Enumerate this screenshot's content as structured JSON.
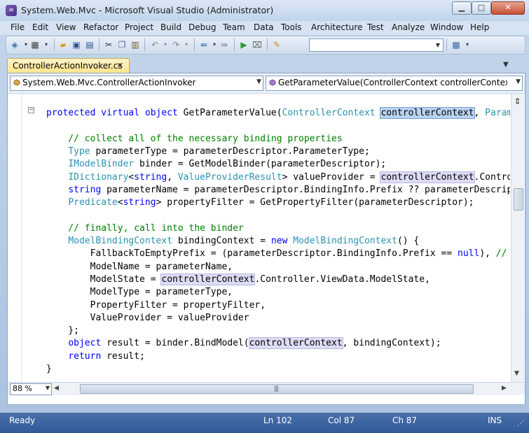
{
  "window": {
    "title": "System.Web.Mvc - Microsoft Visual Studio (Administrator)",
    "controls": {
      "minimize": "▁",
      "maximize": "□",
      "close": "✕"
    }
  },
  "menu": [
    "File",
    "Edit",
    "View",
    "Refactor",
    "Project",
    "Build",
    "Debug",
    "Team",
    "Data",
    "Tools",
    "Architecture",
    "Test",
    "Analyze",
    "Window",
    "Help"
  ],
  "toolbar": {
    "icons": [
      "project-icon",
      "add-item-icon",
      "open-icon",
      "save-icon",
      "save-all-icon",
      "cut-icon",
      "copy-icon",
      "paste-icon",
      "undo-icon",
      "redo-icon",
      "navigate-back-icon",
      "navigate-forward-icon",
      "start-debug-icon",
      "attach-icon",
      "find-in-files-icon",
      "solution-explorer-icon"
    ],
    "find_value": ""
  },
  "tab": {
    "label": "ControllerActionInvoker.cs",
    "close": "✕",
    "overflow": "▼"
  },
  "navigation": {
    "type_combo": "System.Web.Mvc.ControllerActionInvoker",
    "member_combo": "GetParameterValue(ControllerContext controllerContext, Para"
  },
  "code": {
    "collapse_glyph": "−",
    "lines": [
      [
        {
          "t": "protected virtual object ",
          "c": "kw"
        },
        {
          "t": "GetParameterValue(",
          "c": ""
        },
        {
          "t": "ControllerContext",
          "c": "ty"
        },
        {
          "t": " ",
          "c": ""
        },
        {
          "t": "controllerContext",
          "c": "hl-sel"
        },
        {
          "t": ", ",
          "c": ""
        },
        {
          "t": "Param",
          "c": "ty"
        }
      ],
      [],
      [
        {
          "t": "    // collect all of the necessary binding properties",
          "c": "cm"
        }
      ],
      [
        {
          "t": "    ",
          "c": ""
        },
        {
          "t": "Type",
          "c": "ty"
        },
        {
          "t": " parameterType = parameterDescriptor.ParameterType;",
          "c": ""
        }
      ],
      [
        {
          "t": "    ",
          "c": ""
        },
        {
          "t": "IModelBinder",
          "c": "ty"
        },
        {
          "t": " binder = GetModelBinder(parameterDescriptor);",
          "c": ""
        }
      ],
      [
        {
          "t": "    ",
          "c": ""
        },
        {
          "t": "IDictionary",
          "c": "ty"
        },
        {
          "t": "<",
          "c": ""
        },
        {
          "t": "string",
          "c": "kw"
        },
        {
          "t": ", ",
          "c": ""
        },
        {
          "t": "ValueProviderResult",
          "c": "ty"
        },
        {
          "t": "> valueProvider = ",
          "c": ""
        },
        {
          "t": "controllerContext",
          "c": "hl"
        },
        {
          "t": ".Contro",
          "c": ""
        }
      ],
      [
        {
          "t": "    ",
          "c": ""
        },
        {
          "t": "string",
          "c": "kw"
        },
        {
          "t": " parameterName = parameterDescriptor.BindingInfo.Prefix ?? parameterDescrip",
          "c": ""
        }
      ],
      [
        {
          "t": "    ",
          "c": ""
        },
        {
          "t": "Predicate",
          "c": "ty"
        },
        {
          "t": "<",
          "c": ""
        },
        {
          "t": "string",
          "c": "kw"
        },
        {
          "t": "> propertyFilter = GetPropertyFilter(parameterDescriptor);",
          "c": ""
        }
      ],
      [],
      [
        {
          "t": "    // finally, call into the binder",
          "c": "cm"
        }
      ],
      [
        {
          "t": "    ",
          "c": ""
        },
        {
          "t": "ModelBindingContext",
          "c": "ty"
        },
        {
          "t": " bindingContext = ",
          "c": ""
        },
        {
          "t": "new",
          "c": "kw"
        },
        {
          "t": " ",
          "c": ""
        },
        {
          "t": "ModelBindingContext",
          "c": "ty"
        },
        {
          "t": "() {",
          "c": ""
        }
      ],
      [
        {
          "t": "        FallbackToEmptyPrefix = (parameterDescriptor.BindingInfo.Prefix == ",
          "c": ""
        },
        {
          "t": "null",
          "c": "kw"
        },
        {
          "t": "), ",
          "c": ""
        },
        {
          "t": "//",
          "c": "cm"
        }
      ],
      [
        {
          "t": "        ModelName = parameterName,",
          "c": ""
        }
      ],
      [
        {
          "t": "        ModelState = ",
          "c": ""
        },
        {
          "t": "controllerContext",
          "c": "hl"
        },
        {
          "t": ".Controller.ViewData.ModelState,",
          "c": ""
        }
      ],
      [
        {
          "t": "        ModelType = parameterType,",
          "c": ""
        }
      ],
      [
        {
          "t": "        PropertyFilter = propertyFilter,",
          "c": ""
        }
      ],
      [
        {
          "t": "        ValueProvider = valueProvider",
          "c": ""
        }
      ],
      [
        {
          "t": "    };",
          "c": ""
        }
      ],
      [
        {
          "t": "    ",
          "c": ""
        },
        {
          "t": "object",
          "c": "kw"
        },
        {
          "t": " result = binder.BindModel(",
          "c": ""
        },
        {
          "t": "controllerContext",
          "c": "hl"
        },
        {
          "t": ", bindingContext);",
          "c": ""
        }
      ],
      [
        {
          "t": "    ",
          "c": ""
        },
        {
          "t": "return",
          "c": "kw"
        },
        {
          "t": " result;",
          "c": ""
        }
      ],
      [
        {
          "t": "}",
          "c": ""
        }
      ]
    ]
  },
  "editor": {
    "zoom": "88 %",
    "scroll_split": "⇕"
  },
  "status": {
    "state": "Ready",
    "line": "Ln 102",
    "col": "Col 87",
    "ch": "Ch 87",
    "mode": "INS"
  },
  "colors": {
    "keyword": "#0000ff",
    "type": "#2b91af",
    "comment": "#008000",
    "reference_highlight": "#dcdcf5",
    "status_bar": "#2f5a98"
  }
}
